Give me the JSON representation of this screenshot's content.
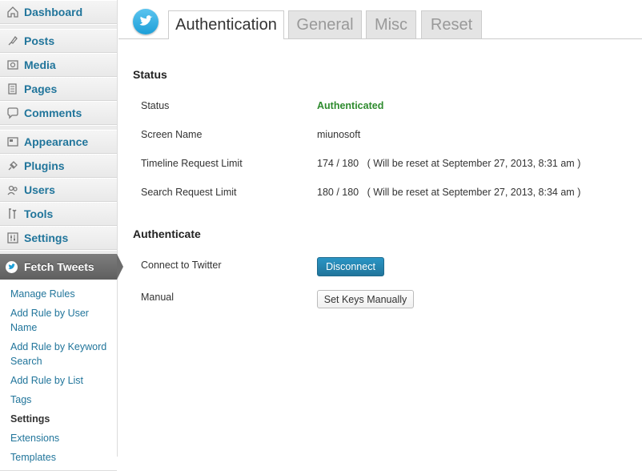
{
  "sidebar": {
    "items": [
      {
        "label": "Dashboard",
        "icon": "dashboard-icon"
      },
      {
        "label": "Posts",
        "icon": "posts-icon"
      },
      {
        "label": "Media",
        "icon": "media-icon"
      },
      {
        "label": "Pages",
        "icon": "pages-icon"
      },
      {
        "label": "Comments",
        "icon": "comments-icon"
      },
      {
        "label": "Appearance",
        "icon": "appearance-icon"
      },
      {
        "label": "Plugins",
        "icon": "plugins-icon"
      },
      {
        "label": "Users",
        "icon": "users-icon"
      },
      {
        "label": "Tools",
        "icon": "tools-icon"
      },
      {
        "label": "Settings",
        "icon": "settings-icon"
      }
    ],
    "active_menu": {
      "label": "Fetch Tweets",
      "icon": "twitter-bird-icon"
    },
    "submenu": [
      {
        "label": "Manage Rules"
      },
      {
        "label": "Add Rule by User Name"
      },
      {
        "label": "Add Rule by Keyword Search"
      },
      {
        "label": "Add Rule by List"
      },
      {
        "label": "Tags"
      },
      {
        "label": "Settings",
        "current": true
      },
      {
        "label": "Extensions"
      },
      {
        "label": "Templates"
      }
    ]
  },
  "tabs": [
    {
      "label": "Authentication",
      "active": true
    },
    {
      "label": "General"
    },
    {
      "label": "Misc"
    },
    {
      "label": "Reset"
    }
  ],
  "status_section": {
    "heading": "Status",
    "rows": [
      {
        "label": "Status",
        "value": "Authenticated"
      },
      {
        "label": "Screen Name",
        "value": "miunosoft"
      },
      {
        "label": "Timeline Request Limit",
        "value": "174 / 180",
        "note": "( Will be reset at September 27, 2013, 8:31 am )"
      },
      {
        "label": "Search Request Limit",
        "value": "180 / 180",
        "note": "( Will be reset at September 27, 2013, 8:34 am )"
      }
    ]
  },
  "authenticate_section": {
    "heading": "Authenticate",
    "connect_label": "Connect to Twitter",
    "disconnect_button": "Disconnect",
    "manual_label": "Manual",
    "manual_button": "Set Keys Manually"
  },
  "colors": {
    "link": "#21759b",
    "authenticated": "#2e8b2e",
    "primary_button": "#21759b"
  }
}
